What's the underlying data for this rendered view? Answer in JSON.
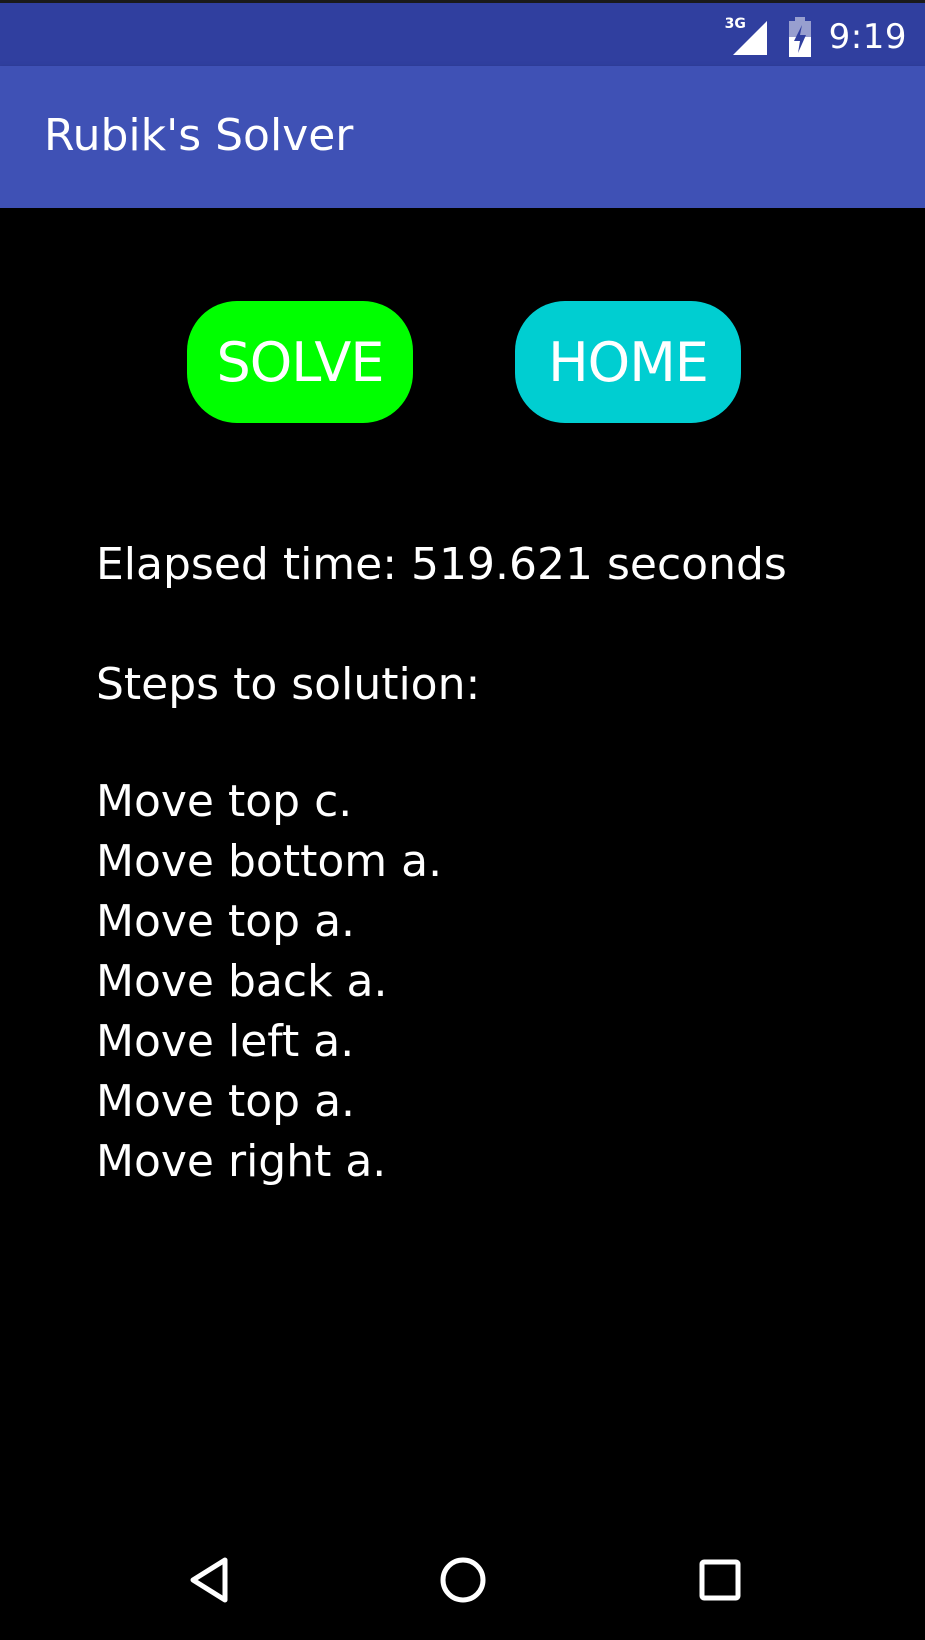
{
  "status_bar": {
    "network_type": "3G",
    "time": "9:19",
    "icons": [
      "signal-icon",
      "battery-icon"
    ]
  },
  "app_bar": {
    "title": "Rubik's Solver",
    "color": "#3F51B5"
  },
  "buttons": {
    "solve_label": "SOLVE",
    "solve_color": "#00FF00",
    "home_label": "HOME",
    "home_color": "#00CED1"
  },
  "result": {
    "elapsed_text": "Elapsed time: 519.621 seconds",
    "steps_heading": "Steps to solution:",
    "steps": [
      "Move top c.",
      "Move bottom a.",
      "Move top a.",
      "Move back a.",
      "Move left a.",
      "Move top a.",
      "Move right a."
    ]
  },
  "nav_bar": {
    "icons": [
      "back-icon",
      "home-icon",
      "recents-icon"
    ]
  }
}
